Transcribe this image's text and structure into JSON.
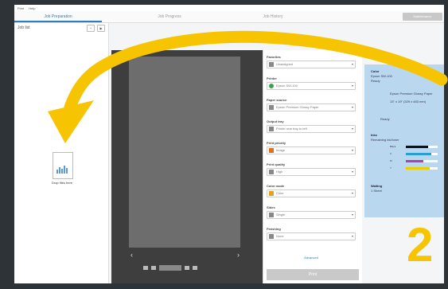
{
  "menu": {
    "items": [
      "Print",
      "Help"
    ]
  },
  "tabs": [
    {
      "label": "Job Preparation",
      "active": true
    },
    {
      "label": "Job Progress",
      "active": false
    },
    {
      "label": "Job History",
      "active": false
    }
  ],
  "top_button": "Maintenance",
  "job_list": {
    "title": "Job list",
    "add_btn": "+",
    "play_btn": "▶",
    "drop_label": "Drop files here"
  },
  "settings": {
    "fields": [
      {
        "label": "Favorites",
        "value": "Unassigned",
        "icon": "star",
        "color": "#888888"
      },
      {
        "label": "Printer",
        "value": "Epson SW-100",
        "icon": "dot",
        "color": "#3aa34a"
      },
      {
        "label": "Paper source",
        "value": "Epson Premium Glossy Paper",
        "icon": "paper",
        "color": "#888888"
      },
      {
        "label": "Output tray",
        "value": "Printer rear tray to left",
        "icon": "tray",
        "color": "#888888"
      },
      {
        "label": "Print priority",
        "value": "Image",
        "icon": "image",
        "color": "#e07020"
      },
      {
        "label": "Print quality",
        "value": "High",
        "icon": "quality",
        "color": "#888888"
      },
      {
        "label": "Color mode",
        "value": "Color",
        "icon": "color",
        "color": "#e5a020"
      },
      {
        "label": "Sides",
        "value": "Single",
        "icon": "sides",
        "color": "#888888"
      },
      {
        "label": "Finishing",
        "value": "None",
        "icon": "finish",
        "color": "#888888"
      }
    ],
    "advanced_label": "Advanced",
    "print_button": "Print"
  },
  "info": {
    "heading": "Color",
    "sub1": "Epson SW-100",
    "sub2": "Ready",
    "media": "Epson Premium Glossy Paper",
    "size": "13\" x 19\" (329 x 483 mm)",
    "status": "Ready",
    "inks_title": "Inks",
    "inks_sub": "Remaining ink/toner",
    "inks": [
      {
        "label": "Black",
        "color": "#111111",
        "level": 0.7
      },
      {
        "label": "C",
        "color": "#2a9fd6",
        "level": 0.8
      },
      {
        "label": "M",
        "color": "#b040b0",
        "level": 0.55
      },
      {
        "label": "Y",
        "color": "#e8d000",
        "level": 0.75
      }
    ],
    "waiting_title": "Waiting",
    "waiting_value": "1 Sheet"
  },
  "preview": {
    "prev": "‹",
    "next": "›"
  },
  "overlay": {
    "step_number": "2",
    "arrow_color": "#f6c400"
  }
}
